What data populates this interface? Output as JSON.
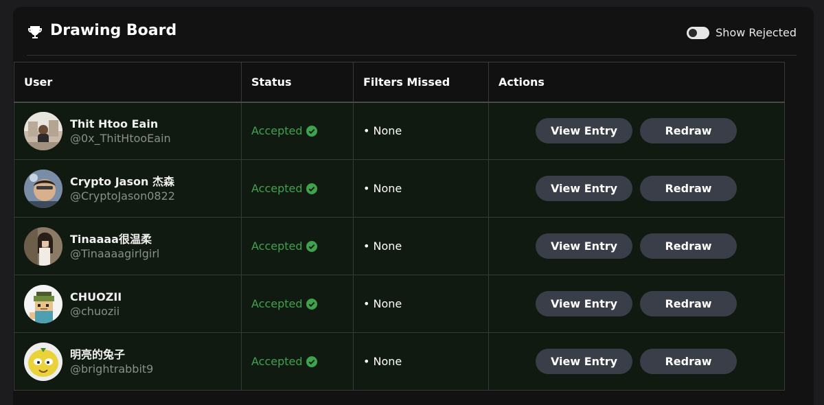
{
  "header": {
    "title": "Drawing Board",
    "toggle_label": "Show Rejected"
  },
  "table": {
    "columns": [
      "User",
      "Status",
      "Filters Missed",
      "Actions"
    ],
    "rows": [
      {
        "name": "Thit Htoo Eain",
        "handle": "@0x_ThitHtooEain",
        "status": "Accepted",
        "filters": "• None",
        "view": "View Entry",
        "redraw": "Redraw"
      },
      {
        "name": "Crypto Jason 杰森",
        "handle": "@CryptoJason0822",
        "status": "Accepted",
        "filters": "• None",
        "view": "View Entry",
        "redraw": "Redraw"
      },
      {
        "name": "Tinaaaa很温柔",
        "handle": "@Tinaaaagirlgirl",
        "status": "Accepted",
        "filters": "• None",
        "view": "View Entry",
        "redraw": "Redraw"
      },
      {
        "name": "CHUOZII",
        "handle": "@chuozii",
        "status": "Accepted",
        "filters": "• None",
        "view": "View Entry",
        "redraw": "Redraw"
      },
      {
        "name": "明亮的兔子",
        "handle": "@brightrabbit9",
        "status": "Accepted",
        "filters": "• None",
        "view": "View Entry",
        "redraw": "Redraw"
      }
    ]
  },
  "colors": {
    "accepted": "#3fa34d",
    "button_bg": "#3a3e48",
    "row_bg": "#111a11"
  }
}
